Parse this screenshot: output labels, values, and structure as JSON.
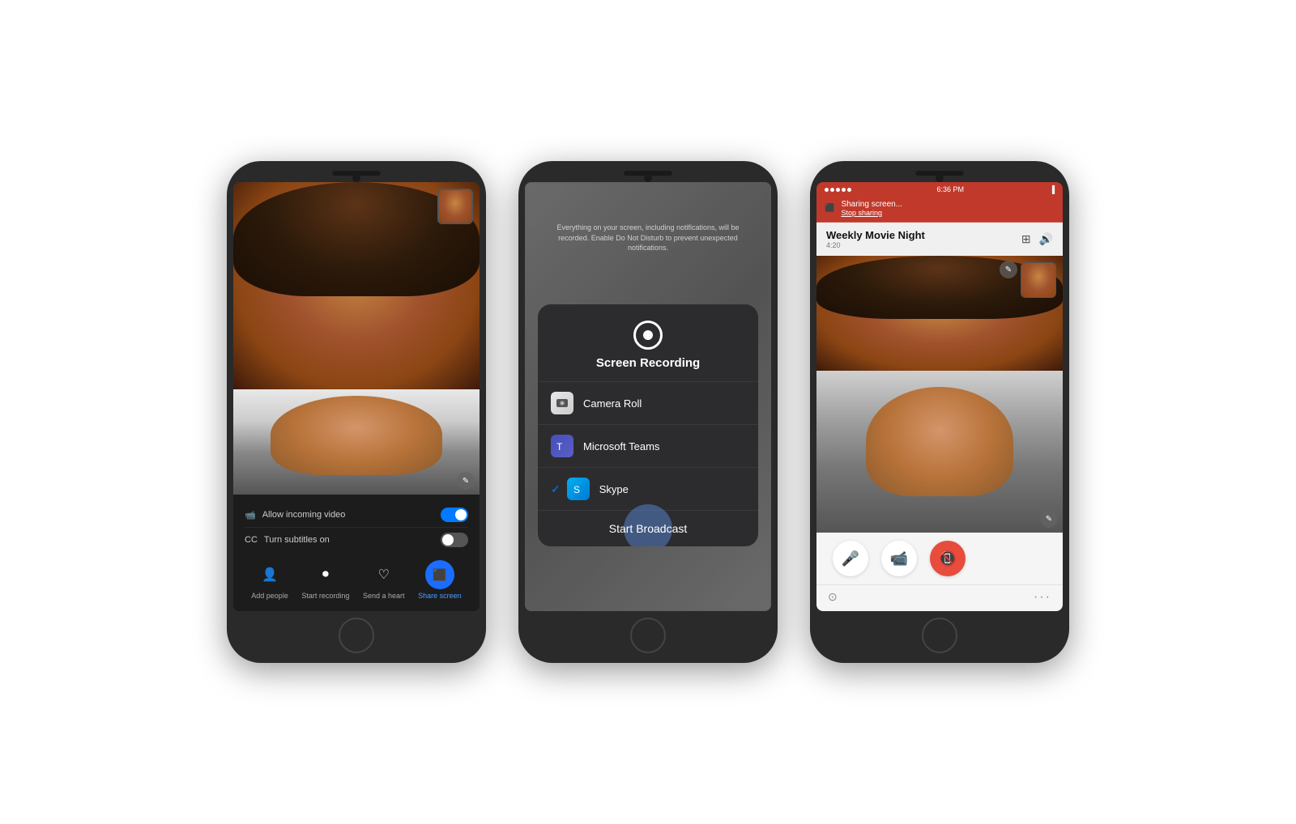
{
  "page": {
    "background": "#ffffff"
  },
  "phone1": {
    "label": "phone-1-skype-call",
    "controls": {
      "incoming_video_label": "Allow incoming video",
      "subtitles_label": "Turn subtitles on",
      "incoming_video_on": true,
      "subtitles_on": false
    },
    "actions": [
      {
        "id": "add-people",
        "label": "Add people",
        "icon": "👤+"
      },
      {
        "id": "start-recording",
        "label": "Start recording",
        "icon": "⏺"
      },
      {
        "id": "send-heart",
        "label": "Send a heart",
        "icon": "♡"
      },
      {
        "id": "share-screen",
        "label": "Share screen",
        "icon": "⬛",
        "active": true
      }
    ]
  },
  "phone2": {
    "label": "phone-2-screen-recording",
    "hint_text": "Everything on your screen, including notifications, will be recorded. Enable Do Not Disturb to prevent unexpected notifications.",
    "picker": {
      "title": "Screen Recording",
      "items": [
        {
          "id": "camera-roll",
          "label": "Camera Roll",
          "icon": "camera"
        },
        {
          "id": "microsoft-teams",
          "label": "Microsoft Teams",
          "icon": "teams"
        },
        {
          "id": "skype",
          "label": "Skype",
          "icon": "skype",
          "selected": true
        }
      ],
      "broadcast_button": "Start Broadcast"
    }
  },
  "phone3": {
    "label": "phone-3-sharing-active",
    "status_bar": {
      "dots": "•••••",
      "wifi": "wifi",
      "time": "6:36 PM",
      "battery": "battery"
    },
    "sharing_bar": {
      "icon": "share",
      "label": "Sharing screen...",
      "stop": "Stop sharing"
    },
    "call_header": {
      "title": "Weekly Movie Night",
      "time": "4:20",
      "layout_icon": "⊞",
      "speaker_icon": "🔊"
    },
    "controls": {
      "mic_icon": "🎤",
      "video_icon": "📹",
      "end_icon": "📵"
    }
  }
}
